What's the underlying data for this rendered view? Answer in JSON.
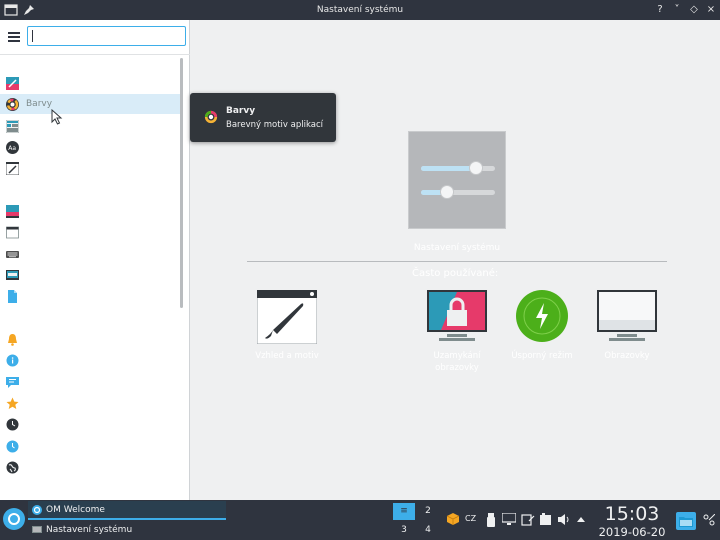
{
  "window": {
    "title": "Nastavení systému",
    "buttons": [
      "?",
      "˅",
      "◇",
      "×"
    ]
  },
  "sidebar": {
    "search_placeholder": "",
    "hovered_label": "Barvy",
    "items": [
      {
        "icon": "appearance-icon",
        "label": ""
      },
      {
        "icon": "colors-icon",
        "label": "Barvy"
      },
      {
        "icon": "workspace-theme-icon",
        "label": ""
      },
      {
        "icon": "fonts-icon",
        "label": ""
      },
      {
        "icon": "edit-icon",
        "label": ""
      },
      {
        "icon": "desktop-behavior-icon",
        "label": ""
      },
      {
        "icon": "window-icon",
        "label": ""
      },
      {
        "icon": "keyboard-icon",
        "label": ""
      },
      {
        "icon": "display-icon",
        "label": ""
      },
      {
        "icon": "document-icon",
        "label": ""
      },
      {
        "icon": "notification-icon",
        "label": ""
      },
      {
        "icon": "info-icon",
        "label": ""
      },
      {
        "icon": "message-icon",
        "label": ""
      },
      {
        "icon": "star-icon",
        "label": ""
      },
      {
        "icon": "clock-icon",
        "label": ""
      },
      {
        "icon": "time-icon",
        "label": ""
      },
      {
        "icon": "globe-icon",
        "label": ""
      }
    ]
  },
  "tooltip": {
    "title": "Barvy",
    "subtitle": "Barevný motiv aplikací"
  },
  "main": {
    "hero_label": "Nastavení systému",
    "frequent_label": "Často používané:",
    "favorites": [
      {
        "icon": "look-and-feel-icon",
        "label_line1": "Vzhled a motiv",
        "label_line2": ""
      },
      {
        "icon": "screen-lock-icon",
        "label_line1": "Uzamykání",
        "label_line2": "obrazovky"
      },
      {
        "icon": "power-saving-icon",
        "label_line1": "Úsporný režim",
        "label_line2": ""
      },
      {
        "icon": "display-settings-icon",
        "label_line1": "Obrazovky",
        "label_line2": ""
      }
    ]
  },
  "taskbar": {
    "tasks": [
      {
        "label": "OM Welcome",
        "active": true
      },
      {
        "label": "Nastavení systému",
        "active": false
      }
    ],
    "pager": [
      "1",
      "2",
      "3",
      "4"
    ],
    "keyboard_layout": "CZ",
    "time": "15:03",
    "date": "2019-06-20"
  },
  "colors": {
    "accent": "#3daee9",
    "titlebar": "#2f343f",
    "tooltip_bg": "#31363b",
    "power_green": "#4caf1a"
  }
}
